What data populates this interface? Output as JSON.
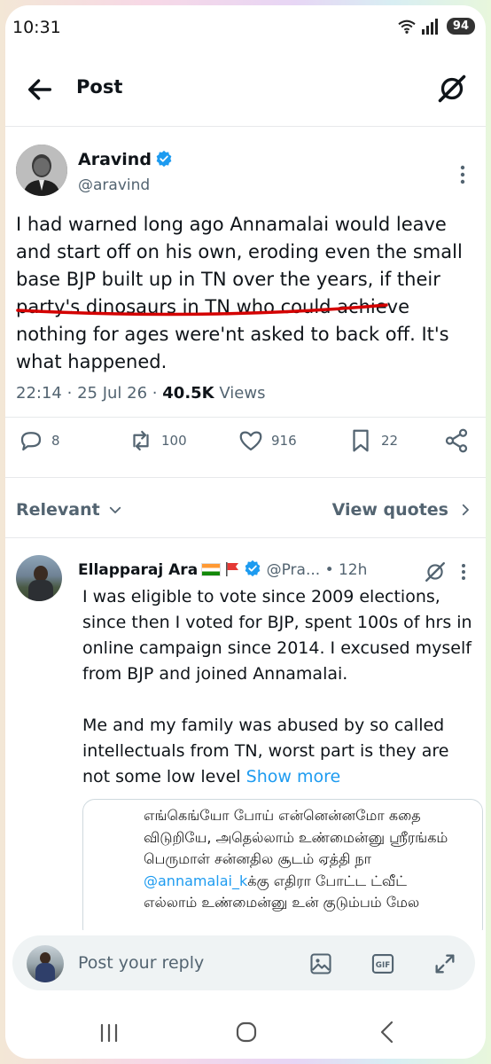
{
  "status_bar": {
    "time": "10:31",
    "battery": "94"
  },
  "header": {
    "title": "Post"
  },
  "post": {
    "author_name": "Aravind",
    "author_handle": "@aravind",
    "text": "I had warned long ago Annamalai would leave and start off on his own, eroding even the small base BJP built up in TN over the years, if their party's dinosaurs in TN who could achieve nothing for ages were'nt asked to back off. It's what happened.",
    "time": "22:14",
    "sep": "·",
    "date": "25 Jul 26",
    "views_count": "40.5K",
    "views_label": "Views",
    "replies": "8",
    "reposts": "100",
    "likes": "916",
    "bookmarks": "22"
  },
  "filters": {
    "relevant": "Relevant",
    "view_quotes": "View quotes"
  },
  "reply": {
    "name": "Ellapparaj Ara",
    "handle": "@Pra...",
    "time": "• 12h",
    "text": "I was eligible to vote since 2009 elections, since then I voted for BJP, spent 100s of hrs in online campaign since 2014. I excused myself from BJP and joined Annamalai.",
    "text2": "Me and my family was abused by so called intellectuals from TN, worst part is they are not some low level",
    "show_more": "Show more",
    "quote_before": "எங்கெங்யோ போய் என்னென்னமோ கதை விடுறியே, அதெல்லாம் உண்மைன்னு ஸ்ரீரங்கம் பெருமாள் சன்னதில சூடம் ஏத்தி நா",
    "quote_mention": "@annamalai_k",
    "quote_after": "க்கு எதிரா போட்ட ட்வீட் எல்லாம் உண்மைன்னு உன் குடும்பம் மேல"
  },
  "reply_bar": {
    "placeholder": "Post your reply",
    "gif": "GIF"
  },
  "colors": {
    "accent": "#1d9bf0",
    "underline": "#d40000",
    "text": "#0f1419",
    "muted": "#536471"
  }
}
